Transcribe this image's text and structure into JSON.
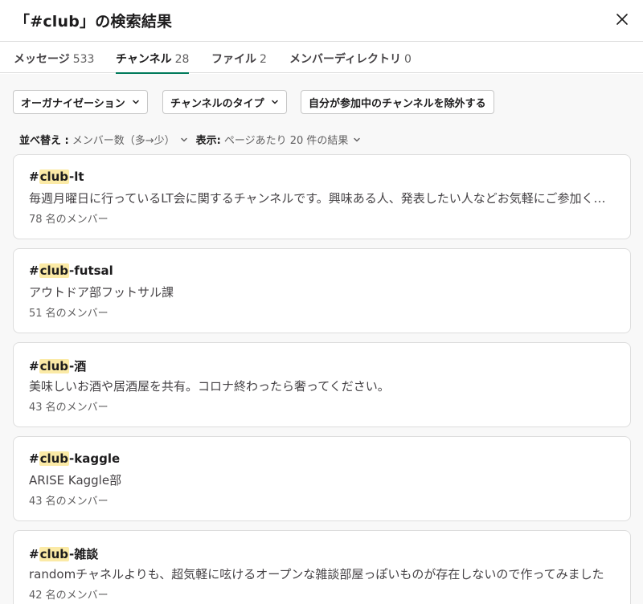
{
  "header": {
    "title": "「#club」の検索結果",
    "close_icon": "close-icon"
  },
  "tabs": [
    {
      "label": "メッセージ",
      "count": "533",
      "active": false
    },
    {
      "label": "チャンネル",
      "count": "28",
      "active": true
    },
    {
      "label": "ファイル",
      "count": "2",
      "active": false
    },
    {
      "label": "メンバーディレクトリ",
      "count": "0",
      "active": false
    }
  ],
  "filters": {
    "organization": "オーガナイゼーション",
    "channel_type": "チャンネルのタイプ",
    "exclude_joined": "自分が参加中のチャンネルを除外する"
  },
  "sort": {
    "label": "並べ替え :",
    "value": "メンバー数（多→少）",
    "display_label": "表示:",
    "display_value": "ページあたり 20 件の結果"
  },
  "results": [
    {
      "prefix": "#",
      "highlight": "club",
      "suffix": "-lt",
      "description": "毎週月曜日に行っているLT会に関するチャンネルです。興味ある人、発表したい人などお気軽にご参加ください！",
      "members": "78 名のメンバー"
    },
    {
      "prefix": "#",
      "highlight": "club",
      "suffix": "-futsal",
      "description": "アウトドア部フットサル課",
      "members": "51 名のメンバー"
    },
    {
      "prefix": "#",
      "highlight": "club",
      "suffix": "-酒",
      "description": "美味しいお酒や居酒屋を共有。コロナ終わったら奢ってください。",
      "members": "43 名のメンバー"
    },
    {
      "prefix": "#",
      "highlight": "club",
      "suffix": "-kaggle",
      "description": "ARISE Kaggle部",
      "members": "43 名のメンバー"
    },
    {
      "prefix": "#",
      "highlight": "club",
      "suffix": "-雑談",
      "description": "randomチャネルよりも、超気軽に呟けるオープンな雑談部屋っぽいものが存在しないので作ってみました",
      "members": "42 名のメンバー"
    }
  ],
  "colors": {
    "accent": "#007a5a",
    "highlight": "#fbeaa6"
  }
}
